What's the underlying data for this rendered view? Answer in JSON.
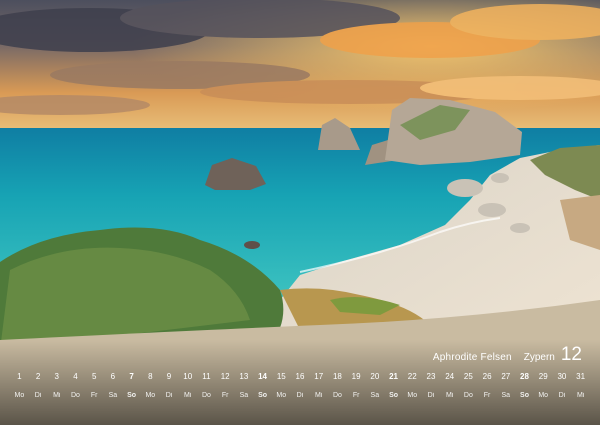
{
  "caption": {
    "title": "Aphrodite Felsen",
    "month_name": "Zypern",
    "month_number": "12"
  },
  "calendar": {
    "days": [
      {
        "num": "1",
        "wd": "Mo"
      },
      {
        "num": "2",
        "wd": "Di"
      },
      {
        "num": "3",
        "wd": "Mi"
      },
      {
        "num": "4",
        "wd": "Do"
      },
      {
        "num": "5",
        "wd": "Fr"
      },
      {
        "num": "6",
        "wd": "Sa"
      },
      {
        "num": "7",
        "wd": "So"
      },
      {
        "num": "8",
        "wd": "Mo"
      },
      {
        "num": "9",
        "wd": "Di"
      },
      {
        "num": "10",
        "wd": "Mi"
      },
      {
        "num": "11",
        "wd": "Do"
      },
      {
        "num": "12",
        "wd": "Fr"
      },
      {
        "num": "13",
        "wd": "Sa"
      },
      {
        "num": "14",
        "wd": "So"
      },
      {
        "num": "15",
        "wd": "Mo"
      },
      {
        "num": "16",
        "wd": "Di"
      },
      {
        "num": "17",
        "wd": "Mi"
      },
      {
        "num": "18",
        "wd": "Do"
      },
      {
        "num": "19",
        "wd": "Fr"
      },
      {
        "num": "20",
        "wd": "Sa"
      },
      {
        "num": "21",
        "wd": "So"
      },
      {
        "num": "22",
        "wd": "Mo"
      },
      {
        "num": "23",
        "wd": "Di"
      },
      {
        "num": "24",
        "wd": "Mi"
      },
      {
        "num": "25",
        "wd": "Do"
      },
      {
        "num": "26",
        "wd": "Fr"
      },
      {
        "num": "27",
        "wd": "Sa"
      },
      {
        "num": "28",
        "wd": "So"
      },
      {
        "num": "29",
        "wd": "Mo"
      },
      {
        "num": "30",
        "wd": "Di"
      },
      {
        "num": "31",
        "wd": "Mi"
      }
    ]
  },
  "colors": {
    "sea": "#1fa9b8",
    "sky_warm": "#e9963f",
    "sky_dark": "#4a4a58"
  }
}
